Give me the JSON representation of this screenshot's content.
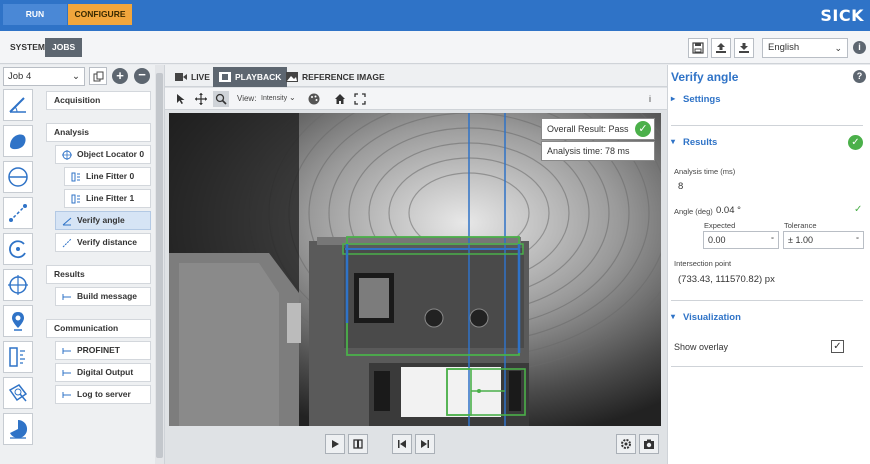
{
  "topbar": {
    "run": "RUN",
    "configure": "CONFIGURE",
    "logo": "SICK"
  },
  "secbar": {
    "system": "SYSTEM",
    "jobs": "JOBS",
    "language": "English"
  },
  "left": {
    "job": "Job 4",
    "sections": {
      "acquisition": "Acquisition",
      "analysis": "Analysis",
      "results": "Results",
      "communication": "Communication"
    },
    "analysis_items": [
      "Object Locator 0",
      "Line Fitter 0",
      "Line Fitter 1",
      "Verify angle",
      "Verify distance"
    ],
    "results_items": [
      "Build message"
    ],
    "communication_items": [
      "PROFINET",
      "Digital Output",
      "Log to server"
    ]
  },
  "center": {
    "tabs": [
      "LIVE",
      "PLAYBACK",
      "REFERENCE IMAGE"
    ],
    "view_label": "View:",
    "view_value": "Intensity",
    "overall_result": "Overall Result: Pass",
    "analysis_time": "Analysis time: 78 ms",
    "info": "i"
  },
  "right": {
    "title": "Verify angle",
    "settings": "Settings",
    "results": "Results",
    "analysis_time_label": "Analysis time (ms)",
    "analysis_time_value": "8",
    "angle_label": "Angle (deg)",
    "angle_value": "0.04 °",
    "expected_label": "Expected",
    "expected_value": "0.00",
    "expected_unit": "°",
    "tolerance_label": "Tolerance",
    "tolerance_value": "± 1.00",
    "tolerance_unit": "°",
    "intersection_label": "Intersection point",
    "intersection_value": "(733.43, 111570.82) px",
    "visualization": "Visualization",
    "show_overlay": "Show overlay"
  },
  "colors": {
    "brand": "#2f73c7",
    "accent": "#f2a63c",
    "ok": "#4bb04a"
  }
}
